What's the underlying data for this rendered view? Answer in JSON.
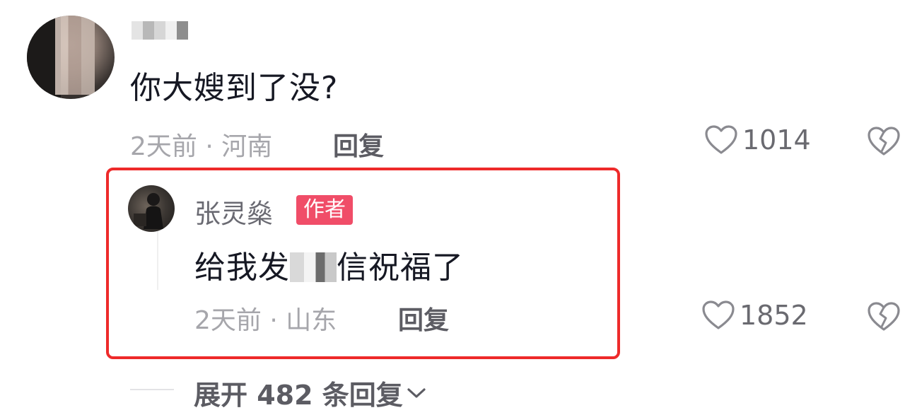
{
  "comment": {
    "username": "",
    "text": "你大嫂到了没?",
    "time": "2天前",
    "separator": "·",
    "location": "河南",
    "reply_label": "回复",
    "likes": "1014",
    "like_icon": "heart-outline-icon",
    "dislike_icon": "broken-heart-icon"
  },
  "reply": {
    "author": "张灵燊",
    "badge": "作者",
    "text_before": "给我发",
    "text_after": "信祝福了",
    "time": "2天前",
    "separator": "·",
    "location": "山东",
    "reply_label": "回复",
    "likes": "1852",
    "like_icon": "heart-outline-icon",
    "dislike_icon": "broken-heart-icon",
    "highlight_color": "#ee2a2a"
  },
  "expand": {
    "label": "展开 482 条回复",
    "icon": "chevron-down-icon"
  },
  "colors": {
    "primary_text": "#161823",
    "secondary_text": "#a6a6ab",
    "badge_bg": "#f04d68"
  }
}
